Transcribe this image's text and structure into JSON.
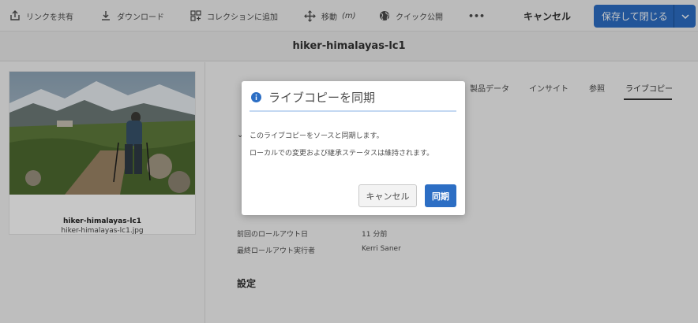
{
  "toolbar": {
    "share_link": "リンクを共有",
    "download": "ダウンロード",
    "add_to_collection": "コレクションに追加",
    "move": "移動",
    "move_shortcut": "(m)",
    "quick_publish": "クイック公開",
    "more": "•••",
    "cancel": "キャンセル",
    "save_close": "保存して閉じる"
  },
  "page_title": "hiker-himalayas-lc1",
  "asset_card": {
    "title": "hiker-himalayas-lc1",
    "filename": "hiker-himalayas-lc1.jpg"
  },
  "tabs": [
    "製品データ",
    "インサイト",
    "参照",
    "ライブコピー"
  ],
  "properties": [
    {
      "label": "前回のロールアウト日",
      "value": "11 分前"
    },
    {
      "label": "最終ロールアウト実行者",
      "value": "Kerri Saner"
    }
  ],
  "section_settings": "設定",
  "dialog": {
    "title": "ライブコピーを同期",
    "body_line1": "このライブコピーをソースと同期します。",
    "body_line2": "ローカルでの変更および継承ステータスは維持されます。",
    "cancel": "キャンセル",
    "confirm": "同期"
  },
  "colors": {
    "accent": "#2c6ec4",
    "info_icon": "#2c6ec4"
  }
}
